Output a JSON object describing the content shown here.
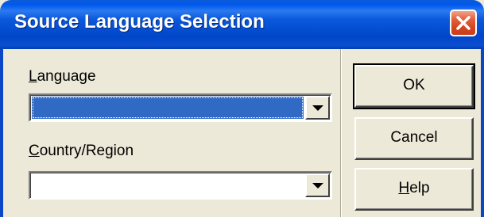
{
  "window": {
    "title": "Source Language Selection"
  },
  "language": {
    "label_prefix": "",
    "label_mnemonic": "L",
    "label_rest": "anguage",
    "value": ""
  },
  "country": {
    "label_prefix": "",
    "label_mnemonic": "C",
    "label_rest": "ountry/Region",
    "value": ""
  },
  "buttons": {
    "ok": "OK",
    "cancel": "Cancel",
    "help_mnemonic": "H",
    "help_rest": "elp"
  },
  "icons": {
    "close": "close-icon",
    "dropdown": "chevron-down-icon"
  },
  "colors": {
    "title_bar": "#0058ee",
    "selection": "#316ac5",
    "close_button": "#d3441f",
    "dialog_background": "#ece9d8"
  }
}
